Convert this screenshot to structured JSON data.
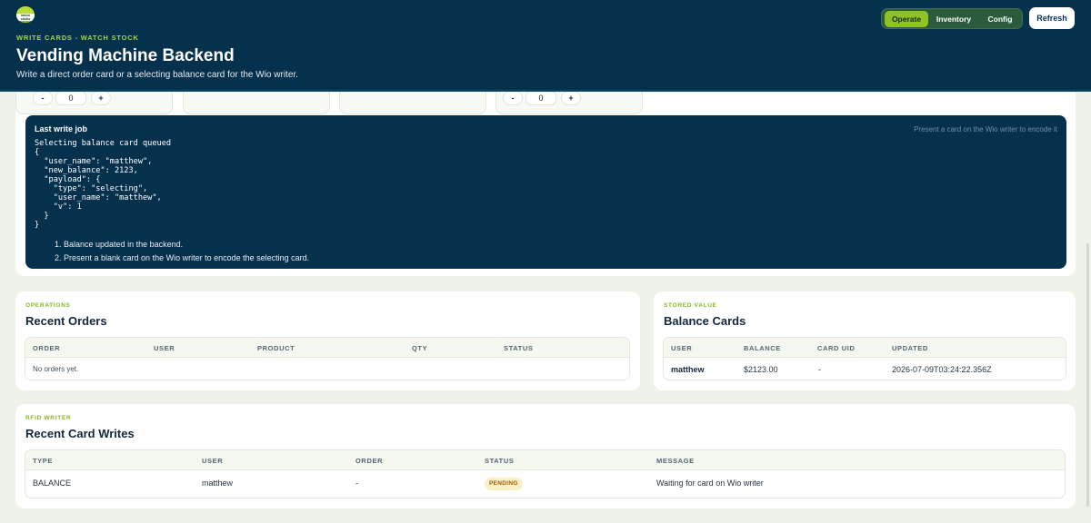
{
  "header": {
    "logo_text": "amiso studio",
    "eyebrow": "WRITE CARDS - WATCH STOCK",
    "title": "Vending Machine Backend",
    "subtitle": "Write a direct order card or a selecting balance card for the Wio writer.",
    "tabs": [
      {
        "label": "Operate",
        "active": true
      },
      {
        "label": "Inventory",
        "active": false
      },
      {
        "label": "Config",
        "active": false
      }
    ],
    "refresh_label": "Refresh"
  },
  "stock_steppers": [
    {
      "minus": "-",
      "value": "0",
      "plus": "+"
    },
    {
      "minus": "-",
      "value": "0",
      "plus": "+"
    }
  ],
  "last_write_job": {
    "title": "Last write job",
    "hint": "Present a card on the Wio writer to encode it",
    "code": "Selecting balance card queued\n{\n  \"user_name\": \"matthew\",\n  \"new_balance\": 2123,\n  \"payload\": {\n    \"type\": \"selecting\",\n    \"user_name\": \"matthew\",\n    \"v\": 1\n  }\n}",
    "steps": [
      "1. Balance updated in the backend.",
      "2. Present a blank card on the Wio writer to encode the selecting card."
    ]
  },
  "recent_orders": {
    "eyebrow": "OPERATIONS",
    "title": "Recent Orders",
    "columns": [
      "ORDER",
      "USER",
      "PRODUCT",
      "QTY",
      "STATUS"
    ],
    "empty_text": "No orders yet."
  },
  "balance_cards": {
    "eyebrow": "STORED VALUE",
    "title": "Balance Cards",
    "columns": [
      "USER",
      "BALANCE",
      "CARD UID",
      "UPDATED"
    ],
    "rows": [
      {
        "user": "matthew",
        "balance": "$2123.00",
        "card_uid": "-",
        "updated": "2026-07-09T03:24:22.356Z"
      }
    ]
  },
  "card_writes": {
    "eyebrow": "RFID WRITER",
    "title": "Recent Card Writes",
    "columns": [
      "TYPE",
      "USER",
      "ORDER",
      "STATUS",
      "MESSAGE"
    ],
    "rows": [
      {
        "type": "BALANCE",
        "user": "matthew",
        "order": "-",
        "status": "PENDING",
        "message": "Waiting for card on Wio writer"
      }
    ]
  },
  "colors": {
    "header_bg": "#06314c",
    "accent": "#8fc224",
    "pending_badge": "#fbefc6"
  }
}
